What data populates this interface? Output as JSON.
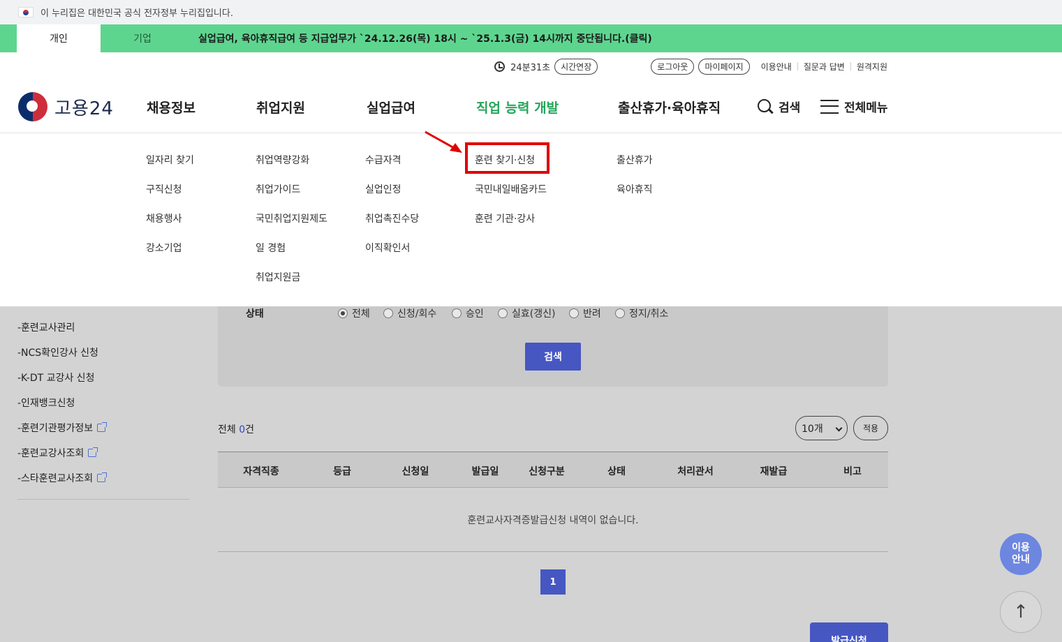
{
  "gov_banner": {
    "text": "이 누리집은 대한민국 공식 전자정부 누리집입니다."
  },
  "notice_bar": {
    "tab_personal": "개인",
    "tab_business": "기업",
    "message": "실업급여, 육아휴직급여 등 지급업무가 `24.12.26(목) 18시 ~ `25.1.3(금) 14시까지 중단됩니다.(클릭)"
  },
  "util": {
    "timer": "24분31초",
    "extend": "시간연장",
    "logout": "로그아웃",
    "mypage": "마이페이지",
    "guide": "이용안내",
    "qna": "질문과 답변",
    "remote": "원격지원"
  },
  "header": {
    "logo_text": "고용24",
    "nav": [
      "채용정보",
      "취업지원",
      "실업급여",
      "직업 능력 개발",
      "출산휴가·육아휴직"
    ],
    "active_nav": "직업 능력 개발",
    "search_label": "검색",
    "allmenu_label": "전체메뉴",
    "accent_color": "#23a55a"
  },
  "mega_menu": {
    "col1": [
      "일자리 찾기",
      "구직신청",
      "채용행사",
      "강소기업"
    ],
    "col2": [
      "취업역량강화",
      "취업가이드",
      "국민취업지원제도",
      "일 경험",
      "취업지원금"
    ],
    "col3": [
      "수급자격",
      "실업인정",
      "취업촉진수당",
      "이직확인서"
    ],
    "col4": [
      "훈련 찾기·신청",
      "국민내일배움카드",
      "훈련 기관·강사"
    ],
    "col5": [
      "출산휴가",
      "육아휴직"
    ],
    "highlighted": "훈련 찾기·신청",
    "highlight_color": "#e00000"
  },
  "sidebar": {
    "items": [
      {
        "label": "-훈련교사관리",
        "external": false
      },
      {
        "label": "-NCS확인강사 신청",
        "external": false
      },
      {
        "label": "-K-DT 교강사 신청",
        "external": false
      },
      {
        "label": "-인재뱅크신청",
        "external": false
      },
      {
        "label": "-훈련기관평가정보",
        "external": true
      },
      {
        "label": "-훈련교강사조회",
        "external": true
      },
      {
        "label": "-스타훈련교사조회",
        "external": true
      }
    ]
  },
  "search_form": {
    "status_label": "상태",
    "options": [
      "전체",
      "신청/회수",
      "승인",
      "실효(갱신)",
      "반려",
      "정지/취소"
    ],
    "selected": "전체",
    "search_button": "검색"
  },
  "results": {
    "total_prefix": "전체",
    "total_count": "0",
    "total_suffix": "건",
    "page_size": "10개",
    "apply_button": "적용",
    "columns": [
      "자격직종",
      "등급",
      "신청일",
      "발급일",
      "신청구분",
      "상태",
      "처리관서",
      "재발급",
      "비고"
    ],
    "empty_message": "훈련교사자격증발급신청 내역이 없습니다.",
    "current_page": "1",
    "issue_button": "발급신청"
  },
  "floating": {
    "help_line1": "이용",
    "help_line2": "안내",
    "top_arrow": "↑"
  },
  "colors": {
    "primary_button": "#4657c2",
    "notice_bg": "#5ed58f"
  }
}
